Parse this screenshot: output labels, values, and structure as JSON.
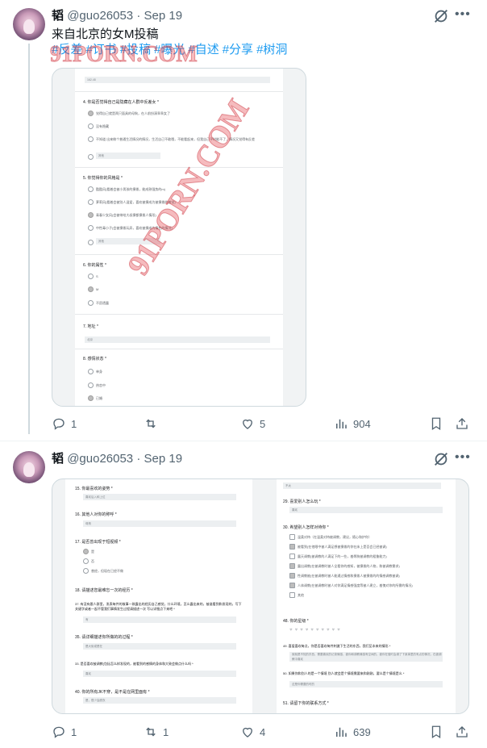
{
  "posts": [
    {
      "author": {
        "display_name": "韬",
        "handle": "@guo26053",
        "date": "· Sep 19"
      },
      "text": "来自北京的女M投稿",
      "hashtags": [
        "#反差",
        "#订书",
        "#投稿",
        "#曝光",
        "#自述",
        "#分享",
        "#树洞"
      ],
      "watermark": [
        "91PORN.COM",
        "91PORN.COM"
      ],
      "form": {
        "top_answer": "162.48",
        "questions": [
          {
            "label": "4. 你是否觉得自己是隐藏在人群中反差女 *",
            "options": [
              "觉得自己就是两只面具的母狗，在人前扮演乖乖女了",
              "没有隐藏",
              "不知道 出来做个普通生活情况的情况，生活自己不敢哦，不能看起来，但我自己平时能不了，情况又觉得有反差",
              "其他"
            ]
          },
          {
            "label": "5. 你觉得你的风格是 *",
            "options": [
              "酷酷风(看着会被小男孩的撩拨，能成熟强势的m)",
              "萝莉风(看着会被别人温爱，喜欢被撩成为被撩拨的感觉)",
              "青春少女风(会被带给大叔撩都撩拨人情形)",
              "中性毒小子(会被撩拨玩弄，喜欢被撩成为情色的情况)",
              "其他"
            ]
          },
          {
            "label": "6. 你的属性 *",
            "options": [
              "S",
              "M",
              "不愿透露"
            ]
          },
          {
            "label": "7. 地址 *",
            "answer": "北京"
          },
          {
            "label": "8. 感情状态 *",
            "options": [
              "单身",
              "热恋中",
              "已婚"
            ]
          }
        ]
      },
      "stats": {
        "replies": "1",
        "reposts": "",
        "likes": "5",
        "views": "904"
      }
    },
    {
      "author": {
        "display_name": "韬",
        "handle": "@guo26053",
        "date": "· Sep 19"
      },
      "form_left": {
        "questions": [
          {
            "label": "15. 你最喜欢的姿势 *",
            "answer": "喜欢后入和上位"
          },
          {
            "label": "16. 其他人对你的称呼 *",
            "answer": "母狗"
          },
          {
            "label": "17. 是否曾出现于短视频 *",
            "options": [
              "是",
              "否",
              "曾经，但现在已经不做"
            ]
          },
          {
            "label": "18. 请描述您最难忘一次的经历 *"
          },
          {
            "label": "37. 有没有跟人群里，发表每件的故事一致露出的经历自己感觉，什么环境，怎么露出来的，被谁看到和发现的，写下关键字或者一起不管我们事情发生过程请描述一次 写以详细点下来吧 *",
            "answer": "有"
          },
          {
            "label": "35. 请详细描述你所做的的过程 *",
            "answer": "是大街或是在"
          },
          {
            "label": "33. 是否喜欢被调教(包括怎么样发现的，被看到的感情的身体和大致会做点什么吗 *",
            "answer": "喜欢"
          },
          {
            "label": "40. 你的所有JK不穿，是不是在网里面有 *",
            "answer": "是，很少会脱衣"
          }
        ]
      },
      "form_right": {
        "top_answer": "不太",
        "questions": [
          {
            "label": "29. 喜爱别人怎么玩 *",
            "answer": "喜欢"
          },
          {
            "label": "30. 希望别人怎样对待你 *",
            "options": [
              "温柔对待（在温柔对待被调教，建议，随心和护你）",
              "被看到(在他眼中被人满足想被撩拨的你在床上是否会已经被调)",
              "露天调教(被调教的人满足下的一些，羞辱狗被调教的粗鲁能力)",
              "露出调教(在被调教时被人全看你的感知，被撩拨的人物，和被调教需求)",
              "性调教被(在被调教时被人能通过情感和撩拨人被撩拨的的情感调教被调)",
              "人体调教(在被调教时被人对你满足情感强度等被人建立，羞愧对你的所需的情况)",
              "其他"
            ]
          },
          {
            "label": "48. 你的星级 *"
          },
          {
            "label": "49. 喜爱喜欢每点，你是否喜欢每件刺激下生活的东西，我们至本来的情形 *",
            "answer": "就就是不知的东西，需要喜欢的记录情感，被你和调教情感有空间的，被你在做时会调了下某事里的有点的情况，在被调教中喜欢"
          },
          {
            "label": "50. 如果你和别人的是一个情境 别人就会是个情境需要来和刚刚，要么是个情境是么 *",
            "answer": "这是你需要的时的"
          },
          {
            "label": "51. 请留下你的联系方式 *"
          }
        ]
      },
      "stats": {
        "replies": "1",
        "reposts": "1",
        "likes": "4",
        "views": "639"
      }
    }
  ],
  "colors": {
    "accent": "#1d9bf0",
    "muted": "#536471",
    "text": "#0f1419",
    "border": "#cfd9de"
  },
  "icons": [
    "grok-icon",
    "more-icon",
    "reply-icon",
    "repost-icon",
    "like-icon",
    "views-icon",
    "bookmark-icon",
    "share-icon"
  ]
}
